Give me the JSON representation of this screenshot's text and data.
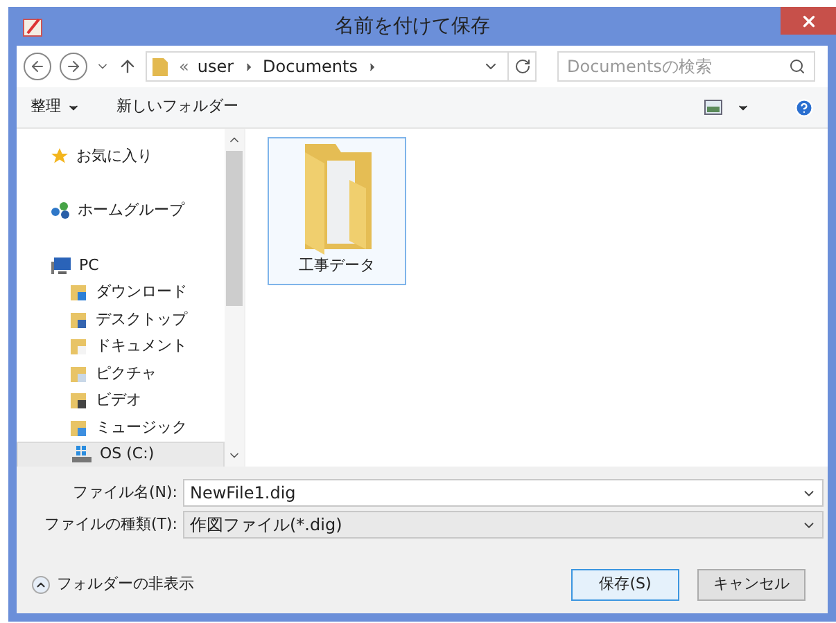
{
  "window": {
    "title": "名前を付けて保存"
  },
  "address": {
    "overflow": "«",
    "path": [
      "user",
      "Documents"
    ]
  },
  "search": {
    "placeholder": "Documentsの検索"
  },
  "toolbar": {
    "organize": "整理",
    "new_folder": "新しいフォルダー"
  },
  "sidebar": [
    {
      "label": "お気に入り",
      "kind": "star",
      "selected": false
    },
    {
      "label": "ホームグループ",
      "kind": "homegroup",
      "selected": false
    },
    {
      "label": "PC",
      "kind": "pc",
      "selected": false,
      "children": [
        {
          "label": "ダウンロード",
          "kind": "download",
          "selected": false
        },
        {
          "label": "デスクトップ",
          "kind": "desktop",
          "selected": false
        },
        {
          "label": "ドキュメント",
          "kind": "documents",
          "selected": false
        },
        {
          "label": "ピクチャ",
          "kind": "pictures",
          "selected": false
        },
        {
          "label": "ビデオ",
          "kind": "videos",
          "selected": false
        },
        {
          "label": "ミュージック",
          "kind": "music",
          "selected": false
        },
        {
          "label": "OS (C:)",
          "kind": "drive",
          "selected": true
        }
      ]
    }
  ],
  "files": [
    {
      "name": "工事データ",
      "selected": true
    }
  ],
  "filename": {
    "label": "ファイル名(N):",
    "value": "NewFile1.dig"
  },
  "filetype": {
    "label": "ファイルの種類(T):",
    "value": "作図ファイル(*.dig)"
  },
  "hide_folders": "フォルダーの非表示",
  "buttons": [
    {
      "label": "保存(S)",
      "kind": "default"
    },
    {
      "label": "キャンセル",
      "kind": "normal"
    }
  ]
}
